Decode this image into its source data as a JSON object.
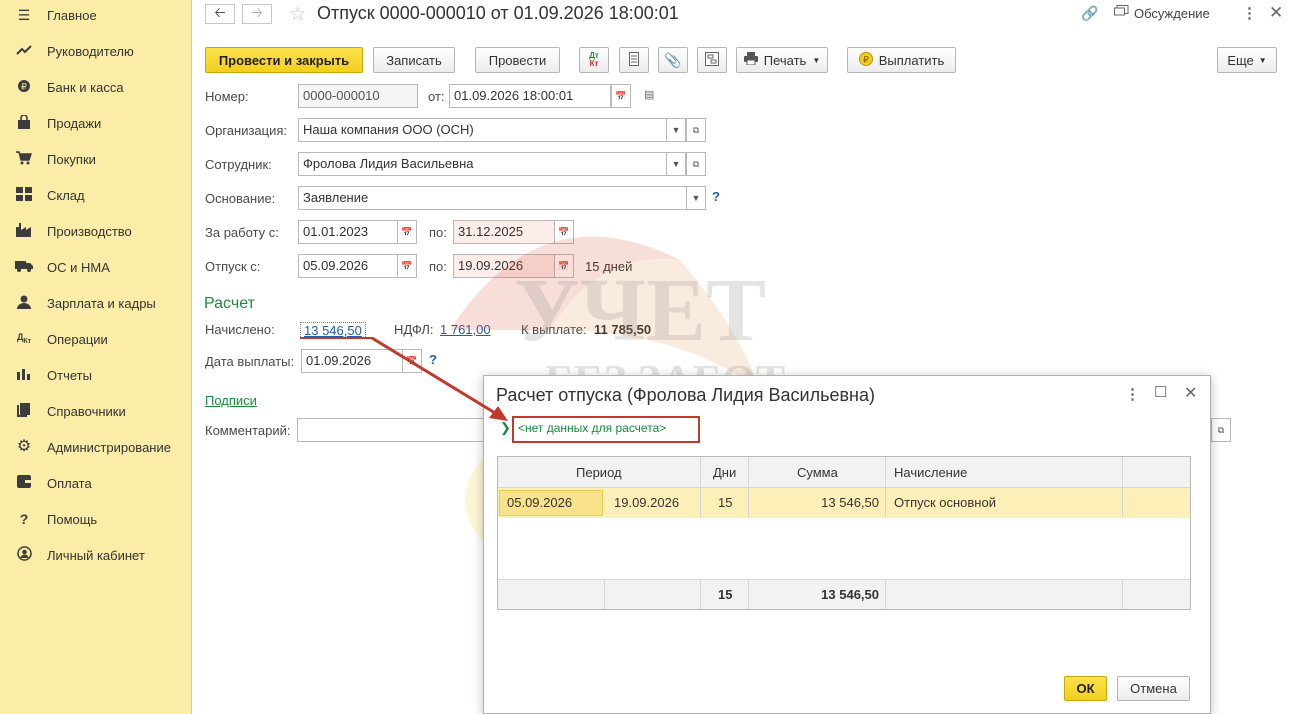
{
  "sidebar": {
    "items": [
      {
        "label": "Главное",
        "icon": "menu-icon"
      },
      {
        "label": "Руководителю",
        "icon": "trend-icon"
      },
      {
        "label": "Банк и касса",
        "icon": "coin-icon"
      },
      {
        "label": "Продажи",
        "icon": "bag-icon"
      },
      {
        "label": "Покупки",
        "icon": "cart-icon"
      },
      {
        "label": "Склад",
        "icon": "warehouse-icon"
      },
      {
        "label": "Производство",
        "icon": "factory-icon"
      },
      {
        "label": "ОС и НМА",
        "icon": "truck-icon"
      },
      {
        "label": "Зарплата и кадры",
        "icon": "person-icon"
      },
      {
        "label": "Операции",
        "icon": "dt-kt-icon"
      },
      {
        "label": "Отчеты",
        "icon": "bar-chart-icon"
      },
      {
        "label": "Справочники",
        "icon": "books-icon"
      },
      {
        "label": "Администрирование",
        "icon": "gear-icon"
      },
      {
        "label": "Оплата",
        "icon": "wallet-icon"
      },
      {
        "label": "Помощь",
        "icon": "question-icon"
      },
      {
        "label": "Личный кабинет",
        "icon": "account-icon"
      }
    ]
  },
  "header": {
    "title": "Отпуск 0000-000010 от 01.09.2026 18:00:01",
    "discussion_label": "Обсуждение"
  },
  "toolbar": {
    "post_close_label": "Провести и закрыть",
    "save_label": "Записать",
    "post_label": "Провести",
    "dt_kt_label": "ДтКт",
    "print_label": "Печать",
    "pay_label": "Выплатить",
    "more_label": "Еще"
  },
  "form": {
    "number_label": "Номер:",
    "number_value": "0000-000010",
    "from_label": "от:",
    "date_value": "01.09.2026 18:00:01",
    "org_label": "Организация:",
    "org_value": "Наша компания ООО (ОСН)",
    "employee_label": "Сотрудник:",
    "employee_value": "Фролова Лидия Васильевна",
    "basis_label": "Основание:",
    "basis_value": "Заявление",
    "work_from_label": "За работу с:",
    "work_from_value": "01.01.2023",
    "to_label": "по:",
    "work_to_value": "31.12.2025",
    "vacation_from_label": "Отпуск с:",
    "vacation_from_value": "05.09.2026",
    "vacation_to_value": "19.09.2026",
    "days_text": "15 дней",
    "calc_header": "Расчет",
    "accrued_label": "Начислено:",
    "accrued_value": "13 546,50",
    "ndfl_label": "НДФЛ:",
    "ndfl_value": "1 761,00",
    "payout_label": "К выплате:",
    "payout_value": "11 785,50",
    "pay_date_label": "Дата выплаты:",
    "pay_date_value": "01.09.2026",
    "signatures_label": "Подписи",
    "comment_label": "Комментарий:",
    "help_mark": "?"
  },
  "watermark": {
    "line1": "УЧЕТ",
    "line2": "БЕЗ ЗАБОТ"
  },
  "dialog": {
    "title": "Расчет отпуска (Фролова Лидия Васильевна)",
    "no_data_link": "<нет данных для расчета>",
    "columns": [
      "Период",
      "Дни",
      "Сумма",
      "Начисление"
    ],
    "rows": [
      {
        "period_from": "05.09.2026",
        "period_to": "19.09.2026",
        "days": "15",
        "amount": "13 546,50",
        "accrual": "Отпуск основной"
      }
    ],
    "totals": {
      "days": "15",
      "amount": "13 546,50"
    },
    "ok_label": "ОК",
    "cancel_label": "Отмена"
  },
  "colors": {
    "sidebar_bg": "#fbeca7",
    "primary_button": "#f2cf1e",
    "link_blue": "#1e5fa8",
    "link_green": "#1a8a3c",
    "highlight_red": "#c0392b",
    "selected_row": "#fcf0b8"
  }
}
